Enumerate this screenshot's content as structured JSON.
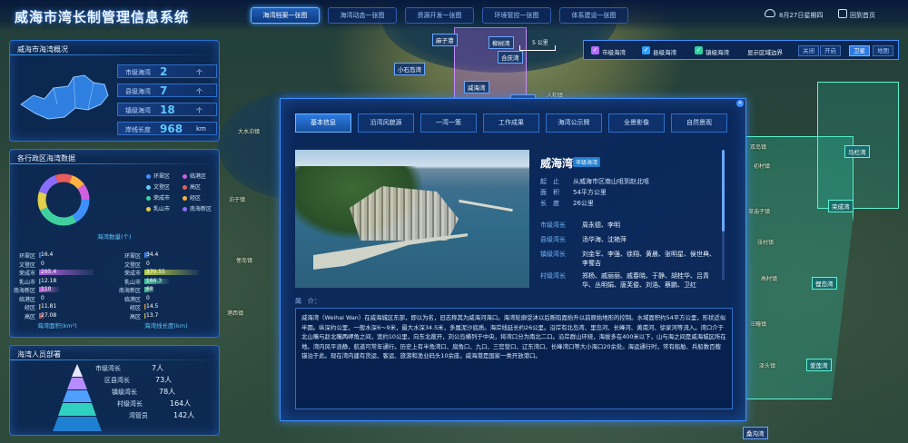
{
  "header": {
    "title": "威海市湾长制管理信息系统",
    "nav": [
      "海湾档案一张图",
      "海湾动态一张图",
      "资源开发一张图",
      "环境管控一张图",
      "体系建设一张图"
    ],
    "date": "8月27日星期四",
    "home": "回到首页"
  },
  "overview": {
    "title": "威海市海湾概况",
    "stats": [
      {
        "label": "市级海湾",
        "value": "2",
        "unit": "个"
      },
      {
        "label": "县级海湾",
        "value": "7",
        "unit": "个"
      },
      {
        "label": "镇级海湾",
        "value": "18",
        "unit": "个"
      },
      {
        "label": "岸线长度",
        "value": "968",
        "unit": "km"
      }
    ]
  },
  "district": {
    "title": "各行政区海湾数据",
    "legend": [
      {
        "name": "环翠区",
        "color": "#3f8fff"
      },
      {
        "name": "临港区",
        "color": "#d060e0"
      },
      {
        "name": "文登区",
        "color": "#6cc8ff"
      },
      {
        "name": "高区",
        "color": "#e85c5c"
      },
      {
        "name": "荣成市",
        "color": "#40d0a0"
      },
      {
        "name": "经区",
        "color": "#ffb040"
      },
      {
        "name": "乳山市",
        "color": "#e0d04a"
      },
      {
        "name": "南海新区",
        "color": "#8a6cff"
      }
    ],
    "donut_caption": "海湾数量(个)",
    "area_caption": "海湾面积(km²)",
    "shore_caption": "海湾线长度(km)",
    "area_rows": [
      {
        "name": "环翠区",
        "value": "16.4"
      },
      {
        "name": "文登区",
        "value": "0"
      },
      {
        "name": "荣成市",
        "value": "295.4"
      },
      {
        "name": "乳山市",
        "value": "12.18"
      },
      {
        "name": "南海新区",
        "value": "110"
      },
      {
        "name": "临港区",
        "value": "0"
      },
      {
        "name": "经区",
        "value": "11.81"
      },
      {
        "name": "高区",
        "value": "27.08"
      }
    ],
    "shore_rows": [
      {
        "name": "环翠区",
        "value": "34.4"
      },
      {
        "name": "文登区",
        "value": "0"
      },
      {
        "name": "荣成市",
        "value": "370.55"
      },
      {
        "name": "乳山市",
        "value": "166.3"
      },
      {
        "name": "南海新区",
        "value": "68"
      },
      {
        "name": "临港区",
        "value": "0"
      },
      {
        "name": "经区",
        "value": "14.5"
      },
      {
        "name": "高区",
        "value": "13.7"
      }
    ]
  },
  "staff": {
    "title": "海湾人员部署",
    "rows": [
      {
        "label": "市级湾长",
        "value": "7人"
      },
      {
        "label": "区县湾长",
        "value": "73人"
      },
      {
        "label": "镇级湾长",
        "value": "78人"
      },
      {
        "label": "村级湾长",
        "value": "164人"
      },
      {
        "label": "湾管员",
        "value": "142人"
      }
    ]
  },
  "modal": {
    "tabs": [
      "基本信息",
      "沿湾风貌源",
      "一湾一策",
      "工作成果",
      "海湾公示牌",
      "全景影像",
      "自然景观"
    ],
    "close": "×",
    "bay_name": "威海湾",
    "bay_badge": "市级海湾",
    "info": [
      {
        "key": "起　止",
        "value": "从威海市区南山咀到赵北咀"
      },
      {
        "key": "面　积",
        "value": "54平方公里"
      },
      {
        "key": "长　度",
        "value": "26公里"
      }
    ],
    "people": [
      {
        "key": "市级湾长",
        "value": "周永德、李明"
      },
      {
        "key": "县级湾长",
        "value": "汤华海、沈艳萍"
      },
      {
        "key": "镇级湾长",
        "value": "刘金军、李强、徐翔、黄晨、张明星、侯世典、李蜀吉"
      },
      {
        "key": "村级湾长",
        "value": "郑杨、戚丽丽、戚春晓、于静、胡桂华、吕青华、丛明娟、唐芙俊、刘浩、蔡鹏、卫红"
      }
    ],
    "intro_label": "简　介：",
    "intro": "威海湾（Weihai Wan）在威海城区东部，即以为名，旧志称其为威海河海口。海湾轮廓受沐以后断陷面抬升以前原始地形的控制。水域面积约54平方公里，形状近似半圆。纵深约公里，一般水深6～9米，最大水深34.5米，多属泥沙底质。海岸线延长约26公里。沿岸有北岛湾、里岛河、长峰河、黄甫河、徐家河等流入。湾口介于北山嘴与赵北嘴两岬角之间，宽约10公里，向东北敞开，刘公岛横列于中央，将湾口分为南北二口。沿岸群山环绕，海拔多在400米以下，山与海之间是威海城区所在地。湾内风平浪静，航道可常年通行。历史上有半角湾口、扇角口、九口、三官营口、辽东湾口、长峰湾口等大小海口20余处。海运通行时，常有船舶、兵船数百艘锚泊于此。现在湾内建有货运、客运、旅游和渔业码头10余座，威海港是国家一类开放港口。"
  },
  "map_controls": {
    "checks": [
      "市级海湾",
      "县级海湾",
      "镇级海湾"
    ],
    "boundary": "显示区域边界",
    "boundary_opts": [
      "关闭",
      "开启"
    ],
    "layer_opts": [
      "卫星",
      "地图"
    ],
    "scale": "5 公里"
  },
  "map_labels": {
    "bays": [
      "麻子港",
      "柳树湾",
      "合庆湾",
      "小石岛湾",
      "威海湾",
      "双岛湾",
      "逍遥湾",
      "马栏湾",
      "荣成湾",
      "俚岛湾",
      "爱莲湾",
      "桑沟湾",
      "石岛湾",
      "靖海湾",
      "五垒岛湾",
      "乳山湾",
      "浪暖口",
      "羊港湾"
    ],
    "towns": [
      "双岛镇",
      "初村镇",
      "草庙子镇",
      "张村镇",
      "高村镇",
      "汪疃镇",
      "泽头镇",
      "大水泊镇",
      "泊于镇",
      "俚岛镇",
      "港西镇",
      "人和镇",
      "寻山街道",
      "宁津街道",
      "港湾街道"
    ]
  }
}
